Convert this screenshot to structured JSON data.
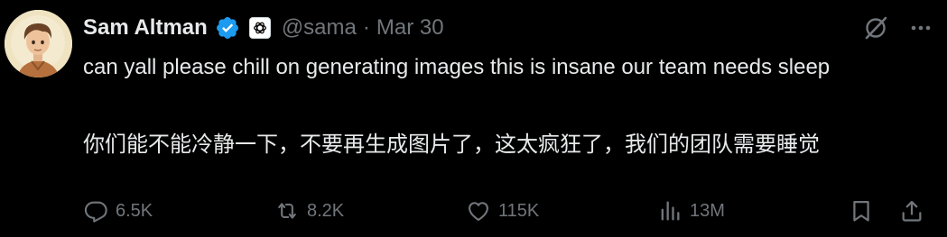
{
  "author": {
    "name": "Sam Altman",
    "handle": "@sama",
    "separator": "·",
    "date": "Mar 30"
  },
  "tweet": {
    "text_en": "can yall please chill on generating images this is insane our team needs sleep",
    "text_zh": "你们能不能冷静一下，不要再生成图片了，这太疯狂了，我们的团队需要睡觉"
  },
  "actions": {
    "replies": "6.5K",
    "retweets": "8.2K",
    "likes": "115K",
    "views": "13M"
  },
  "colors": {
    "background": "#000000",
    "text": "#e7e9ea",
    "muted": "#71767b",
    "verified": "#1d9bf0"
  },
  "icons": {
    "verified": "verified-badge-icon",
    "affiliation": "openai-logo-icon",
    "grok": "grok-icon",
    "more": "more-icon",
    "reply": "reply-icon",
    "retweet": "retweet-icon",
    "like": "heart-icon",
    "views": "views-chart-icon",
    "bookmark": "bookmark-icon",
    "share": "share-icon"
  }
}
